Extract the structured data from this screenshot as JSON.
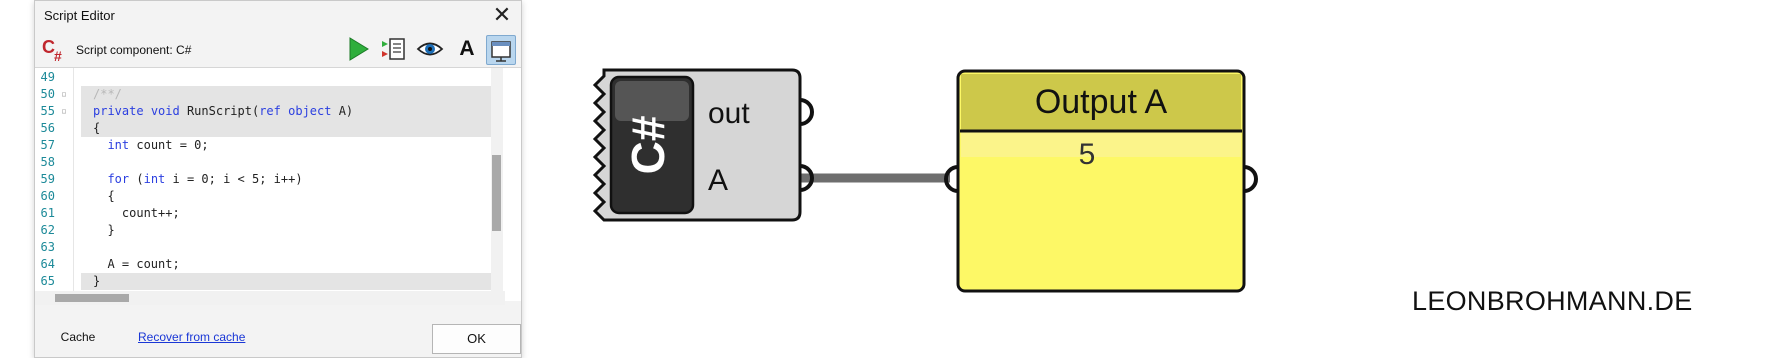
{
  "editor": {
    "title": "Script Editor",
    "close_glyph": "✕",
    "component_label": "Script component: C#",
    "language_icon": "csharp-icon",
    "toolbar": {
      "run_icon": "play-icon",
      "inspect_icon": "inspect-io-icon",
      "preview_icon": "eye-icon",
      "font_label": "A",
      "window_icon": "window-mode-icon"
    },
    "code_lines": [
      {
        "ln": "49",
        "fold": "",
        "text": ""
      },
      {
        "ln": "50",
        "fold": "▫",
        "text": "/**/"
      },
      {
        "ln": "55",
        "fold": "▫",
        "text": "private void RunScript(ref object A)"
      },
      {
        "ln": "56",
        "fold": "",
        "text": "{"
      },
      {
        "ln": "57",
        "fold": "",
        "text": "  int count = 0;"
      },
      {
        "ln": "58",
        "fold": "",
        "text": ""
      },
      {
        "ln": "59",
        "fold": "",
        "text": "  for (int i = 0; i < 5; i++)"
      },
      {
        "ln": "60",
        "fold": "",
        "text": "  {"
      },
      {
        "ln": "61",
        "fold": "",
        "text": "    count++;"
      },
      {
        "ln": "62",
        "fold": "",
        "text": "  }"
      },
      {
        "ln": "63",
        "fold": "",
        "text": ""
      },
      {
        "ln": "64",
        "fold": "",
        "text": "  A = count;"
      },
      {
        "ln": "65",
        "fold": "",
        "text": "}"
      }
    ],
    "footer": {
      "cache_label": "Cache",
      "recover_label": "Recover from cache",
      "ok_label": "OK"
    }
  },
  "canvas": {
    "script_component": {
      "icon_label": "C#",
      "outputs": [
        "out",
        "A"
      ]
    },
    "panel": {
      "title": "Output A",
      "value": "5"
    },
    "colors": {
      "panel_fill": "#fdf866",
      "panel_header": "#cdc84a",
      "component_body": "#d9d9d9",
      "wire": "#6e6e6e"
    }
  },
  "watermark": "LEONBROHMANN.DE"
}
